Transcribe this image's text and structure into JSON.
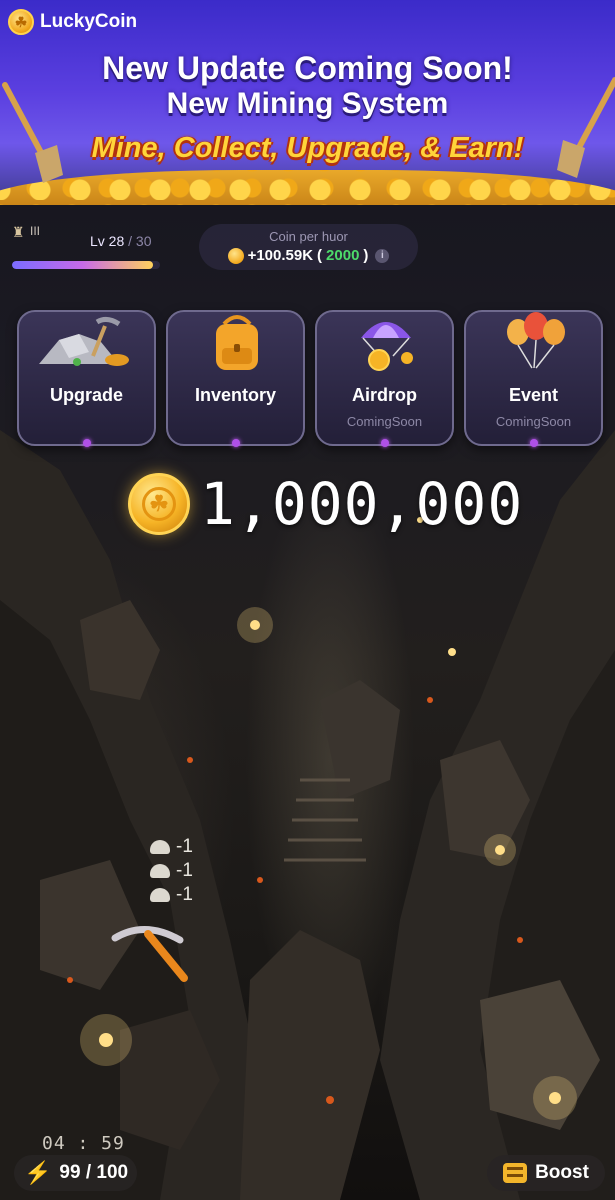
{
  "app": {
    "name": "LuckyCoin"
  },
  "banner": {
    "line1": "New Update Coming Soon!",
    "line2": "New Mining System",
    "line3": "Mine, Collect, Upgrade, & Earn!"
  },
  "level": {
    "rank": "III",
    "label": "Lv 28",
    "separator": " / ",
    "max": "30",
    "progress": 0.95
  },
  "coin_rate": {
    "label": "Coin per huor",
    "value": "+100.59K",
    "open_paren": " (",
    "bonus": "2000",
    "close_paren": ")",
    "info": "i"
  },
  "cards": [
    {
      "title": "Upgrade",
      "subtitle": ""
    },
    {
      "title": "Inventory",
      "subtitle": ""
    },
    {
      "title": "Airdrop",
      "subtitle": "ComingSoon"
    },
    {
      "title": "Event",
      "subtitle": "ComingSoon"
    }
  ],
  "balance": {
    "value": "1,000,000"
  },
  "floats": [
    "-1",
    "-1",
    "-1"
  ],
  "footer": {
    "timer": "04 : 59",
    "energy": "99 / 100",
    "boost_label": "Boost"
  },
  "colors": {
    "accent_purple": "#b050e8",
    "gold": "#f6b426",
    "bonus_green": "#4ddb6a",
    "energy_orange": "#ff8a1f"
  },
  "icons": {
    "brand": "lucky-coin-logo",
    "upgrade": "pickaxe-rock-icon",
    "inventory": "backpack-icon",
    "airdrop": "parachute-coin-icon",
    "event": "balloons-icon",
    "energy": "lightning-icon",
    "boost": "boost-icon"
  }
}
